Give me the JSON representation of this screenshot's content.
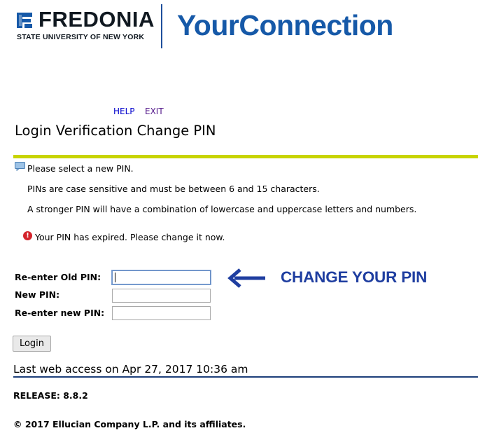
{
  "header": {
    "university_name": "FREDONIA",
    "university_subtitle": "STATE UNIVERSITY OF NEW YORK",
    "app_name": "YourConnection",
    "brand_color": "#1659a8"
  },
  "nav": {
    "help": "HELP",
    "exit": "EXIT"
  },
  "page": {
    "title": "Login Verification Change PIN",
    "info_message": "Please select a new PIN.",
    "rules": [
      "PINs are case sensitive and must be between 6 and 15 characters.",
      "A stronger PIN will have a combination of lowercase and uppercase letters and numbers."
    ],
    "error_message": "Your PIN has expired. Please change it now."
  },
  "form": {
    "old_pin_label": "Re-enter Old PIN:",
    "new_pin_label": "New PIN:",
    "reenter_new_pin_label": "Re-enter new PIN:",
    "old_pin_value": "",
    "new_pin_value": "",
    "reenter_new_pin_value": "",
    "login_button": "Login"
  },
  "annotation": {
    "text": "CHANGE YOUR PIN",
    "color": "#1f3ea0"
  },
  "footer": {
    "last_access": "Last web access on Apr 27, 2017 10:36 am",
    "release": "RELEASE: 8.8.2",
    "copyright": "© 2017 Ellucian Company L.P. and its affiliates."
  },
  "icons": {
    "logo": "fredonia-logo-icon",
    "info": "speech-bubble-icon",
    "error": "exclamation-circle-icon",
    "arrow": "arrow-left-icon"
  }
}
